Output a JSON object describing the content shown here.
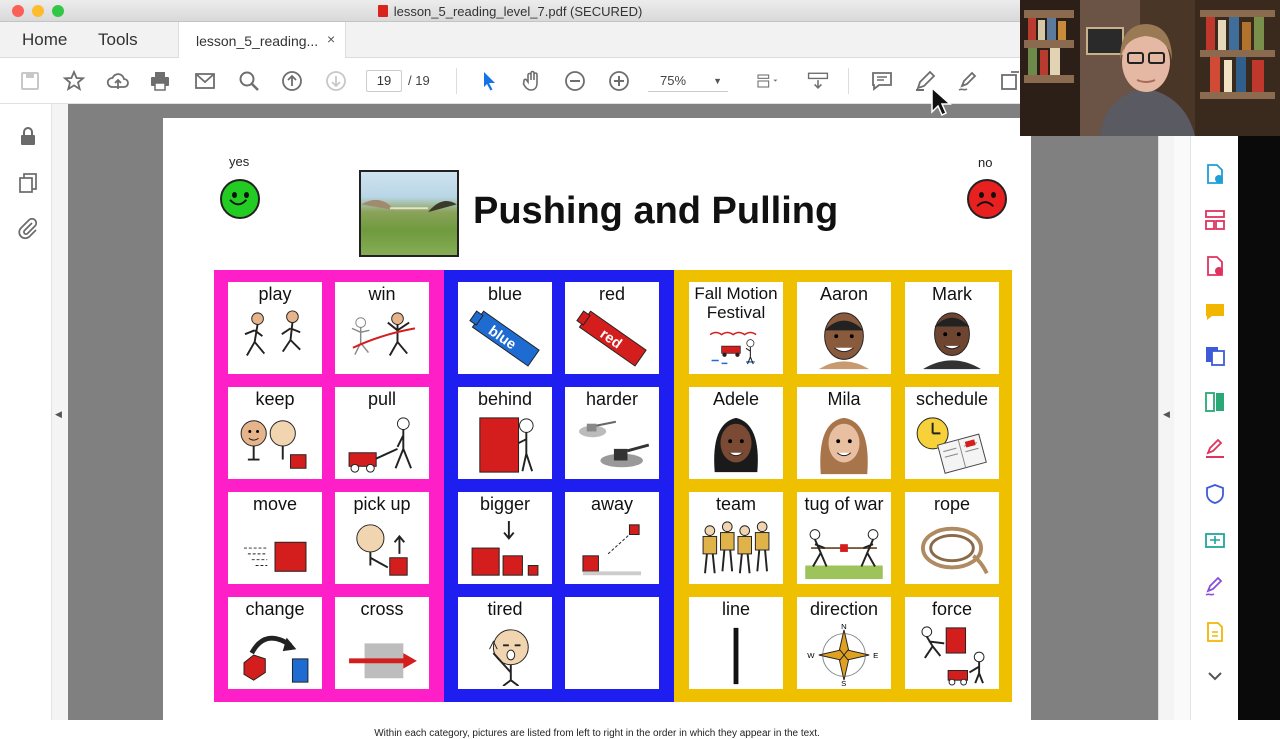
{
  "window": {
    "title": "lesson_5_reading_level_7.pdf (SECURED)"
  },
  "tabs": {
    "home": "Home",
    "tools": "Tools",
    "doc": "lesson_5_reading...",
    "close": "×"
  },
  "toolbar": {
    "page_current": "19",
    "page_total": "/ 19",
    "zoom": "75%"
  },
  "doc": {
    "title": "Pushing and Pulling",
    "yes_label": "yes",
    "no_label": "no",
    "footer_note": "Within each category, pictures are listed from left to right in the order in which they appear in the text."
  },
  "board": {
    "categories": [
      {
        "color": "#ff1fc8",
        "words": [
          "play",
          "win",
          "keep",
          "pull",
          "move",
          "pick up",
          "change",
          "cross"
        ]
      },
      {
        "color": "#1e1ef0",
        "words": [
          "blue",
          "red",
          "behind",
          "harder",
          "bigger",
          "away",
          "tired",
          ""
        ]
      },
      {
        "color": "#eec000",
        "words": [
          "Fall Motion Festival",
          "Aaron",
          "Mark",
          "Adele",
          "Mila",
          "schedule",
          "team",
          "tug of war",
          "rope",
          "line",
          "direction",
          "force"
        ]
      }
    ]
  },
  "colors": {
    "accent": "#1473e6",
    "pink": "#ff1fc8",
    "blue": "#1e1ef0",
    "yellow": "#eec000"
  }
}
